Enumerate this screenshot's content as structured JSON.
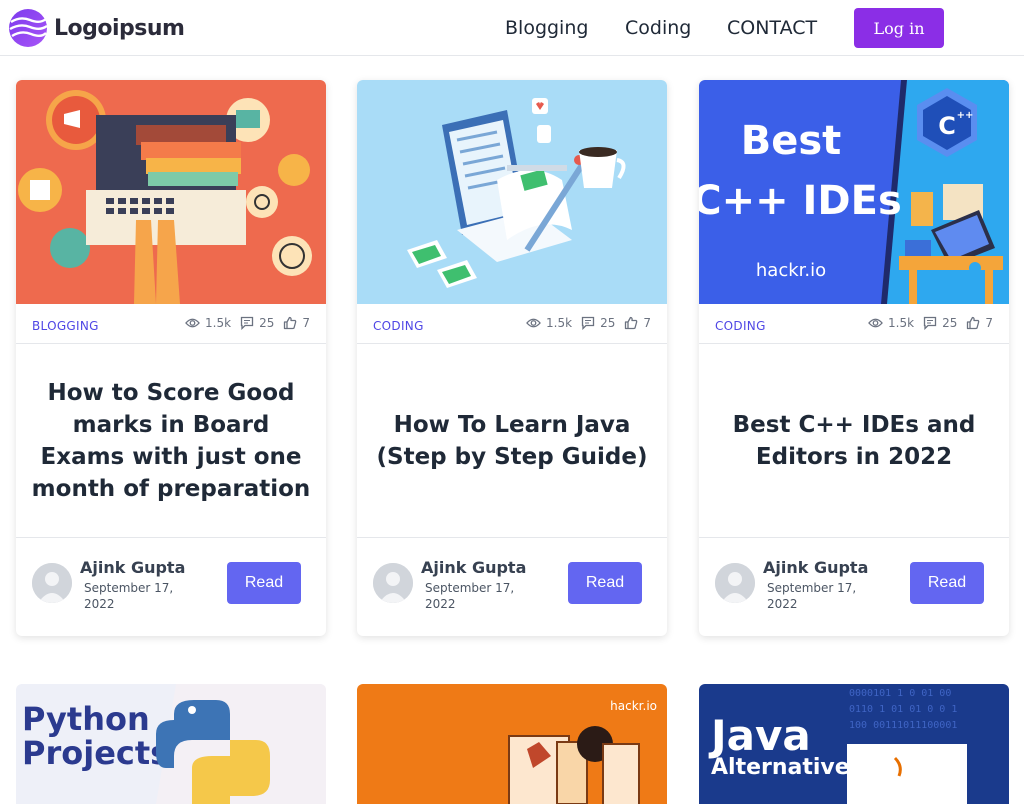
{
  "nav": {
    "logo_text": "Logoipsum",
    "links": [
      "Blogging",
      "Coding",
      "CONTACT"
    ],
    "login_label": "Log in",
    "login_color": "#8b2ee6"
  },
  "cards": [
    {
      "category": "BLOGGING",
      "views": "1.5k",
      "comments": "25",
      "likes": "7",
      "title": "How to Score Good marks in Board Exams with just one month of preparation",
      "author": "Ajink Gupta",
      "date": "September 17, 2022",
      "read_label": "Read",
      "image_icon": "laptop-study-illustration"
    },
    {
      "category": "CODING",
      "views": "1.5k",
      "comments": "25",
      "likes": "7",
      "title": "How To Learn Java (Step by Step Guide)",
      "author": "Ajink Gupta",
      "date": "September 17, 2022",
      "read_label": "Read",
      "image_icon": "laptop-code-illustration"
    },
    {
      "category": "CODING",
      "views": "1.5k",
      "comments": "25",
      "likes": "7",
      "title": "Best C++ IDEs and Editors in 2022",
      "author": "Ajink Gupta",
      "date": "September 17, 2022",
      "read_label": "Read",
      "image_icon": "cpp-ides-banner",
      "image_text": [
        "Best",
        "C++ IDEs",
        "hackr.io"
      ]
    }
  ],
  "cards_second_row": [
    {
      "image_text": [
        "Python",
        "Projects"
      ],
      "image_icon": "python-logo"
    },
    {
      "image_text": [
        "hackr.io"
      ],
      "image_icon": "person-illustration"
    },
    {
      "image_text": [
        "Java",
        "Alternatives"
      ],
      "image_icon": "java-banner"
    }
  ],
  "colors": {
    "accent": "#6366f1",
    "category": "#4f46e5"
  }
}
